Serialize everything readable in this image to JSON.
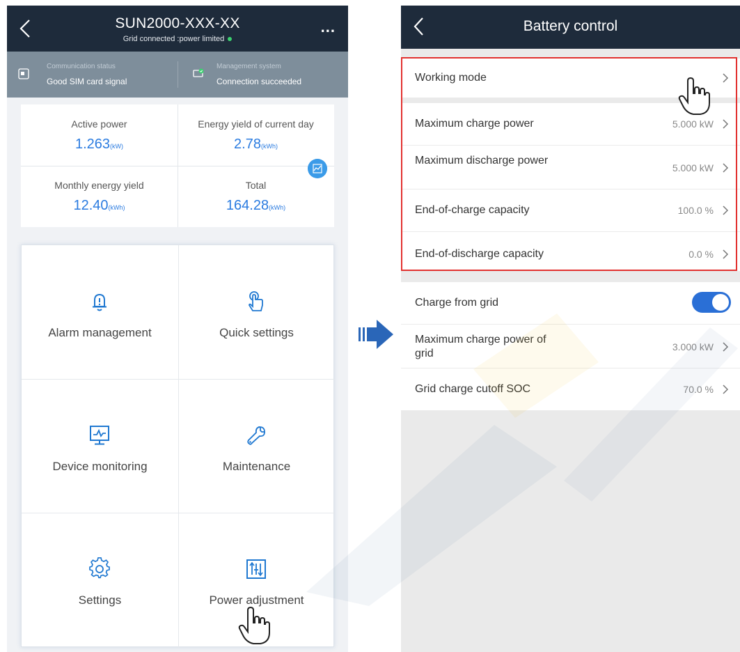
{
  "left": {
    "title": "SUN2000-XXX-XX",
    "subtitle": "Grid connected :power limited",
    "status": [
      {
        "label": "Communication status",
        "value": "Good SIM card signal"
      },
      {
        "label": "Management system",
        "value": "Connection succeeded"
      }
    ],
    "kpis": [
      {
        "label": "Active power",
        "value": "1.263",
        "unit": "(kW)"
      },
      {
        "label": "Energy yield of current day",
        "value": "2.78",
        "unit": "(kWh)"
      },
      {
        "label": "Monthly energy yield",
        "value": "12.40",
        "unit": "(kWh)"
      },
      {
        "label": "Total",
        "value": "164.28",
        "unit": "(kWh)"
      }
    ],
    "menu": [
      {
        "label": "Alarm management",
        "icon": "bell-icon"
      },
      {
        "label": "Quick settings",
        "icon": "touch-icon"
      },
      {
        "label": "Device monitoring",
        "icon": "monitor-icon"
      },
      {
        "label": "Maintenance",
        "icon": "wrench-icon"
      },
      {
        "label": "Settings",
        "icon": "gear-icon"
      },
      {
        "label": "Power adjustment",
        "icon": "sliders-icon"
      }
    ]
  },
  "right": {
    "title": "Battery control",
    "rows": [
      {
        "label": "Working mode",
        "value": ""
      },
      {
        "label": "Maximum charge power",
        "value": "5.000 kW"
      },
      {
        "label": "Maximum discharge power",
        "value": "5.000 kW"
      },
      {
        "label": "End-of-charge capacity",
        "value": "100.0 %"
      },
      {
        "label": "End-of-discharge capacity",
        "value": "0.0 %"
      },
      {
        "label": "Charge from grid",
        "value": "",
        "toggle": true
      },
      {
        "label": "Maximum charge power of grid",
        "value": "3.000 kW"
      },
      {
        "label": "Grid charge cutoff SOC",
        "value": "70.0 %"
      }
    ]
  },
  "colors": {
    "header_bg": "#1e2b3b",
    "accent_blue": "#2a7be0",
    "highlight_red": "#e2312f",
    "status_bg": "#7e8e9b"
  }
}
